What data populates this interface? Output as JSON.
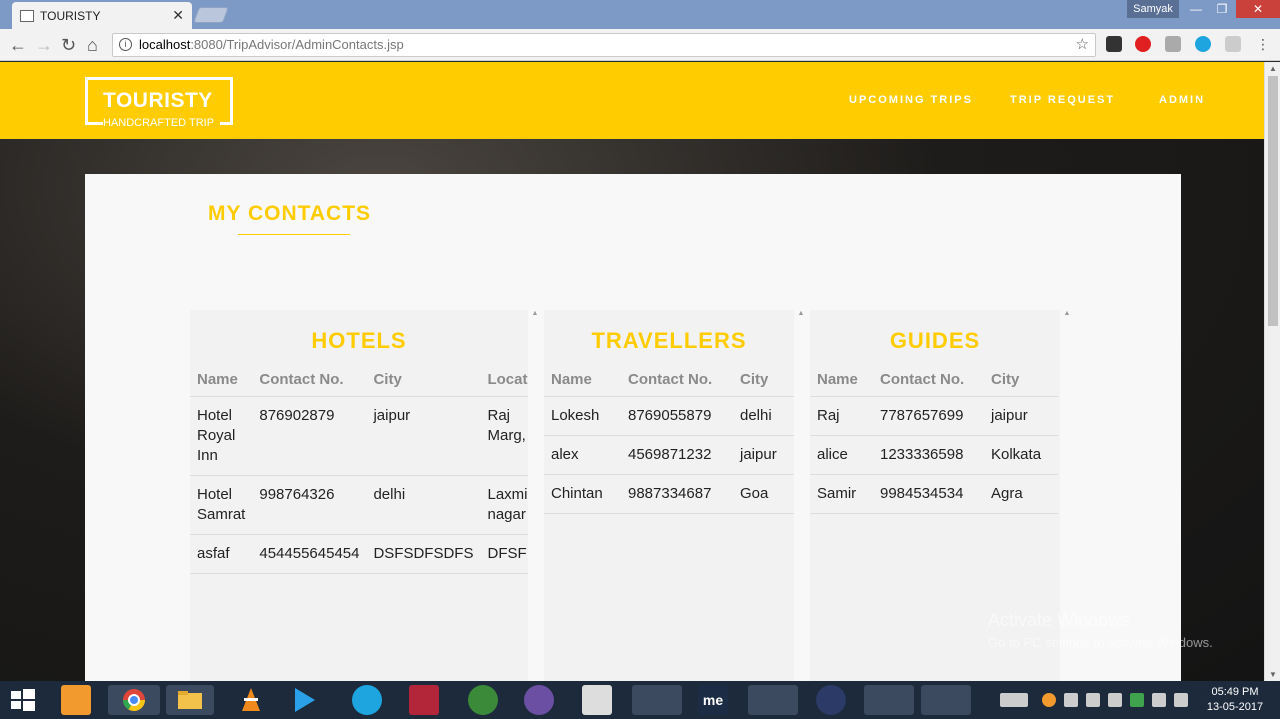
{
  "browser": {
    "tab_title": "TOURISTY",
    "tab_close": "✕",
    "user": "Samyak",
    "url_host": "localhost",
    "url_path": ":8080/TripAdvisor/AdminContacts.jsp",
    "back_icon": "←",
    "forward_icon": "→",
    "reload_icon": "↻",
    "home_icon": "⌂",
    "info_icon": "i",
    "star_icon": "☆",
    "min_icon": "—",
    "max_icon": "❐",
    "close_icon": "✕"
  },
  "site": {
    "brand": "TOURISTY",
    "tagline": "HANDCRAFTED TRIP",
    "nav": [
      "UPCOMING TRIPS",
      "TRIP REQUEST",
      "ADMIN"
    ],
    "page_title": "MY CONTACTS"
  },
  "hotels": {
    "title": "HOTELS",
    "columns": [
      "Name",
      "Contact No.",
      "City",
      "Locat"
    ],
    "rows": [
      [
        "Hotel Royal Inn",
        "876902879",
        "jaipur",
        "Raj Marg,"
      ],
      [
        "Hotel Samrat",
        "998764326",
        "delhi",
        "Laxmi nagar"
      ],
      [
        "asfaf",
        "454455645454",
        "DSFSDFSDFS",
        "DFSF"
      ]
    ]
  },
  "travellers": {
    "title": "TRAVELLERS",
    "columns": [
      "Name",
      "Contact No.",
      "City"
    ],
    "rows": [
      [
        "Lokesh",
        "8769055879",
        "delhi"
      ],
      [
        "alex",
        "4569871232",
        "jaipur"
      ],
      [
        "Chintan",
        "9887334687",
        "Goa"
      ]
    ]
  },
  "guides": {
    "title": "GUIDES",
    "columns": [
      "Name",
      "Contact No.",
      "City"
    ],
    "rows": [
      [
        "Raj",
        "7787657699",
        "jaipur"
      ],
      [
        "alice",
        "1233336598",
        "Kolkata"
      ],
      [
        "Samir",
        "9984534534",
        "Agra"
      ]
    ]
  },
  "watermark": {
    "line1": "Activate Windows",
    "line2": "Go to PC settings to activate Windows."
  },
  "taskbar": {
    "time": "05:49 PM",
    "date": "13-05-2017",
    "me_label": "me"
  },
  "colors": {
    "accent": "#ffcc00",
    "titlebar": "#7d9ac7",
    "taskbar": "#1c2a3c"
  }
}
